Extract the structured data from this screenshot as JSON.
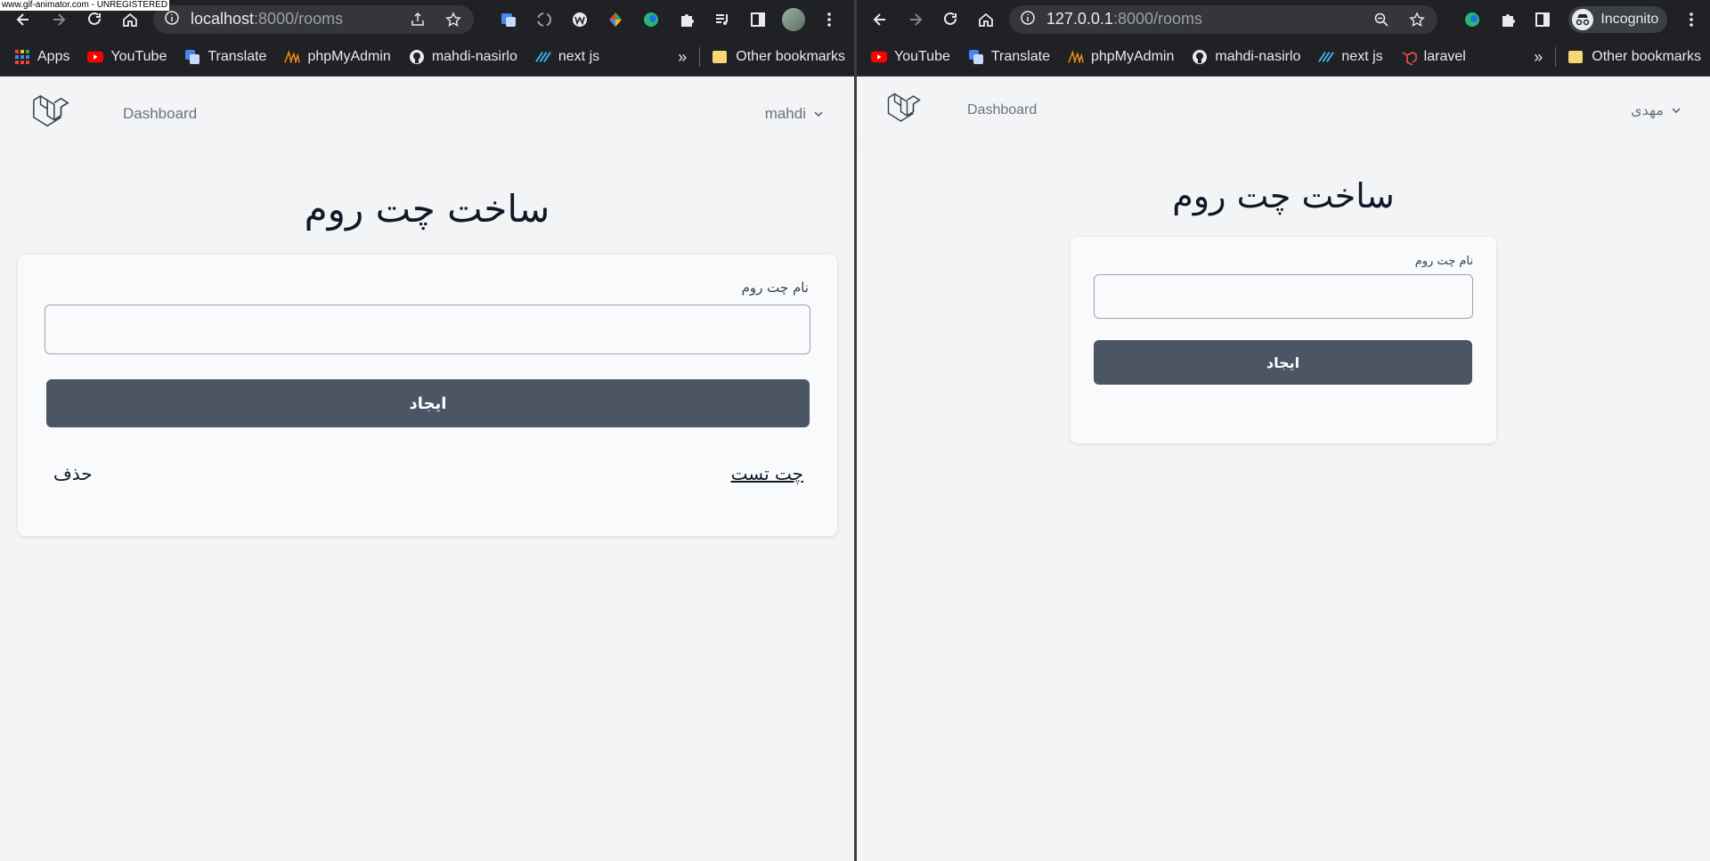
{
  "watermark": "www.gif-animator.com - UNREGISTERED",
  "left_window": {
    "address": {
      "host": "localhost",
      "path": ":8000/rooms"
    },
    "bookmarks": [
      "Apps",
      "YouTube",
      "Translate",
      "phpMyAdmin",
      "mahdi-nasirlo",
      "next js"
    ],
    "more": "»",
    "other_bookmarks": "Other bookmarks",
    "nav": {
      "dashboard": "Dashboard",
      "user": "mahdi"
    },
    "title": "ساخت چت روم",
    "form": {
      "label": "نام چت روم",
      "input_value": "",
      "submit": "ایجاد"
    },
    "rooms": [
      {
        "name": "چت تست",
        "delete": "حذف"
      }
    ]
  },
  "right_window": {
    "address": {
      "host": "127.0.0.1",
      "path": ":8000/rooms"
    },
    "incognito": "Incognito",
    "bookmarks": [
      "YouTube",
      "Translate",
      "phpMyAdmin",
      "mahdi-nasirlo",
      "next js",
      "laravel"
    ],
    "more": "»",
    "other_bookmarks": "Other bookmarks",
    "nav": {
      "dashboard": "Dashboard",
      "user": "مهدی"
    },
    "title": "ساخت چت روم",
    "form": {
      "label": "نام چت روم",
      "input_value": "",
      "submit": "ایجاد"
    }
  },
  "colors": {
    "chrome_bg": "#202124",
    "omnibox_bg": "#35363a",
    "page_bg": "#f3f4f6",
    "button_bg": "#4b5563",
    "youtube_red": "#ff0000",
    "translate_blue": "#4285f4"
  }
}
